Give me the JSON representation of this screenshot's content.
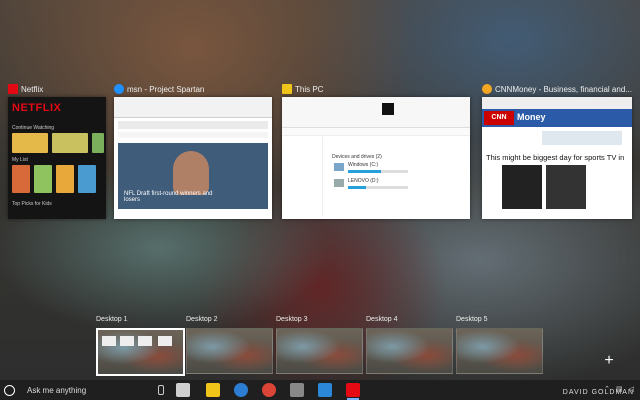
{
  "windows": {
    "netflix": {
      "title": "Netflix",
      "logo": "NETFLIX",
      "row1": "Continue Watching",
      "row2": "My List",
      "row3": "Top Picks for Kids",
      "icon_color": "#e50914"
    },
    "edge": {
      "title": "msn - Project Spartan",
      "headline": "NFL Draft first-round winners and losers",
      "icon_color": "#1e90ff"
    },
    "explorer": {
      "title": "This PC",
      "section": "Devices and drives (2)",
      "drive1": "Windows (C:)",
      "drive2": "LENOVO (D:)",
      "free1": 0.55,
      "free2": 0.3
    },
    "cnn": {
      "title": "CNNMoney - Business, financial and...",
      "logo": "CNN",
      "brand": "Money",
      "headline": "This might be biggest day for sports TV in",
      "icon_color": "#f5a623"
    }
  },
  "desktops": [
    {
      "label": "Desktop 1",
      "active": true
    },
    {
      "label": "Desktop 2",
      "active": false
    },
    {
      "label": "Desktop 3",
      "active": false
    },
    {
      "label": "Desktop 4",
      "active": false
    },
    {
      "label": "Desktop 5",
      "active": false
    }
  ],
  "new_desktop": "+",
  "taskbar": {
    "search_placeholder": "Ask me anything",
    "apps": [
      {
        "name": "task-view",
        "color": "#cfcfcf"
      },
      {
        "name": "file-explorer",
        "color": "#f0c419"
      },
      {
        "name": "edge",
        "color": "#2d7dd2"
      },
      {
        "name": "chrome",
        "color": "#db4437"
      },
      {
        "name": "photos",
        "color": "#888888"
      },
      {
        "name": "store",
        "color": "#2b88d8"
      },
      {
        "name": "netflix",
        "color": "#e50914"
      }
    ]
  },
  "credit": "DAVID GOLDMAN"
}
